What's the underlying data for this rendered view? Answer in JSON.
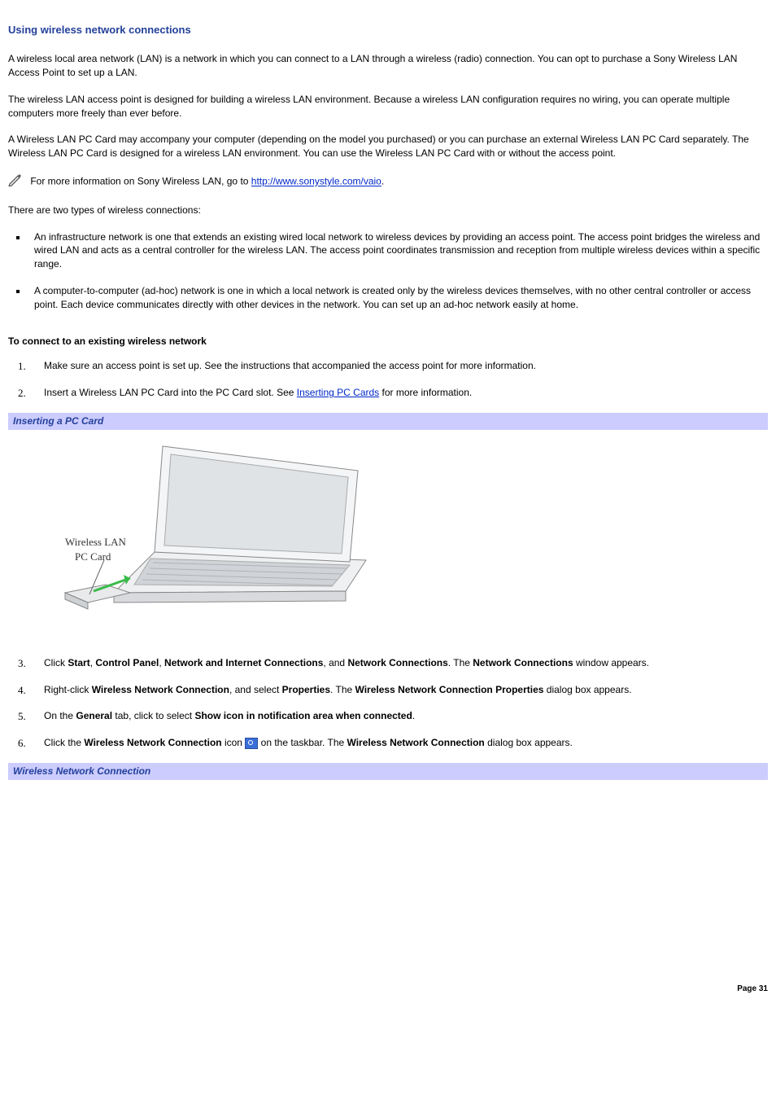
{
  "title": "Using wireless network connections",
  "p1": "A wireless local area network (LAN) is a network in which you can connect to a LAN through a wireless (radio) connection. You can opt to purchase a Sony Wireless LAN Access Point to set up a LAN.",
  "p2": "The wireless LAN access point is designed for building a wireless LAN environment. Because a wireless LAN configuration requires no wiring, you can operate multiple computers more freely than ever before.",
  "p3": "A Wireless LAN PC Card may accompany your computer (depending on the model you purchased) or you can purchase an external Wireless LAN PC Card separately. The Wireless LAN PC Card is designed for a wireless LAN environment. You can use the Wireless LAN PC Card with or without the access point.",
  "note": {
    "pre": "For more information on Sony Wireless LAN, go to ",
    "link_text": "http://www.sonystyle.com/vaio",
    "post": "."
  },
  "p4": "There are two types of wireless connections:",
  "bullets": [
    "An infrastructure network is one that extends an existing wired local network to wireless devices by providing an access point. The access point bridges the wireless and wired LAN and acts as a central controller for the wireless LAN. The access point coordinates transmission and reception from multiple wireless devices within a specific range.",
    "A computer-to-computer (ad-hoc) network is one in which a local network is created only by the wireless devices themselves, with no other central controller or access point. Each device communicates directly with other devices in the network. You can set up an ad-hoc network easily at home."
  ],
  "subhead": "To connect to an existing wireless network",
  "steps": {
    "s1": "Make sure an access point is set up. See the instructions that accompanied the access point for more information.",
    "s2": {
      "pre": "Insert a Wireless LAN PC Card into the PC Card slot. See ",
      "link": "Inserting PC Cards",
      "post": " for more information."
    },
    "s3": {
      "t_click": "Click ",
      "b_start": "Start",
      "c1": ", ",
      "b_cp": "Control Panel",
      "c2": ", ",
      "b_nic": "Network and Internet Connections",
      "c3": ", and ",
      "b_nc": "Network Connections",
      "c4": ". The ",
      "b_nc2": "Network Connections",
      "tail": " window appears."
    },
    "s4": {
      "t1": "Right-click ",
      "b_wnc": "Wireless Network Connection",
      "t2": ", and select ",
      "b_prop": "Properties",
      "t3": ". The ",
      "b_wncp": "Wireless Network Connection Properties",
      "t4": " dialog box appears."
    },
    "s5": {
      "t1": "On the ",
      "b_gen": "General",
      "t2": " tab, click to select ",
      "b_show": "Show icon in notification area when connected",
      "t3": "."
    },
    "s6": {
      "t1": "Click the ",
      "b_wnc": "Wireless Network Connection",
      "t2": " icon ",
      "t3": " on the taskbar. The ",
      "b_wnc2": "Wireless Network Connection",
      "t4": " dialog box appears."
    }
  },
  "fig1": {
    "caption": "Inserting a PC Card",
    "label1": "Wireless LAN",
    "label2": "PC Card"
  },
  "fig2_caption": "Wireless Network Connection",
  "footer": "Page 31"
}
